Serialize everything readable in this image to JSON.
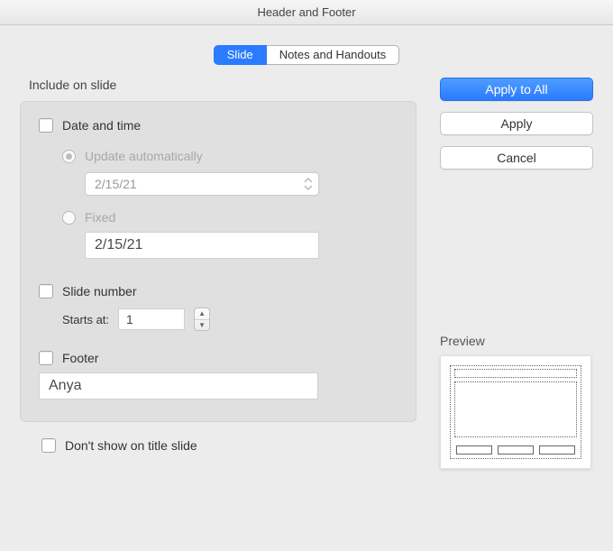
{
  "window": {
    "title": "Header and Footer"
  },
  "tabs": {
    "slide": "Slide",
    "notes": "Notes and Handouts"
  },
  "group": {
    "include_label": "Include on slide"
  },
  "datetime": {
    "label": "Date and time",
    "update_auto_label": "Update automatically",
    "auto_value": "2/15/21",
    "fixed_label": "Fixed",
    "fixed_value": "2/15/21"
  },
  "slidenum": {
    "label": "Slide number",
    "starts_at_label": "Starts at:",
    "starts_at_value": "1"
  },
  "footer": {
    "label": "Footer",
    "value": "Anya"
  },
  "dont_show": {
    "label": "Don't show on title slide"
  },
  "buttons": {
    "apply_all": "Apply to All",
    "apply": "Apply",
    "cancel": "Cancel"
  },
  "preview": {
    "label": "Preview"
  }
}
